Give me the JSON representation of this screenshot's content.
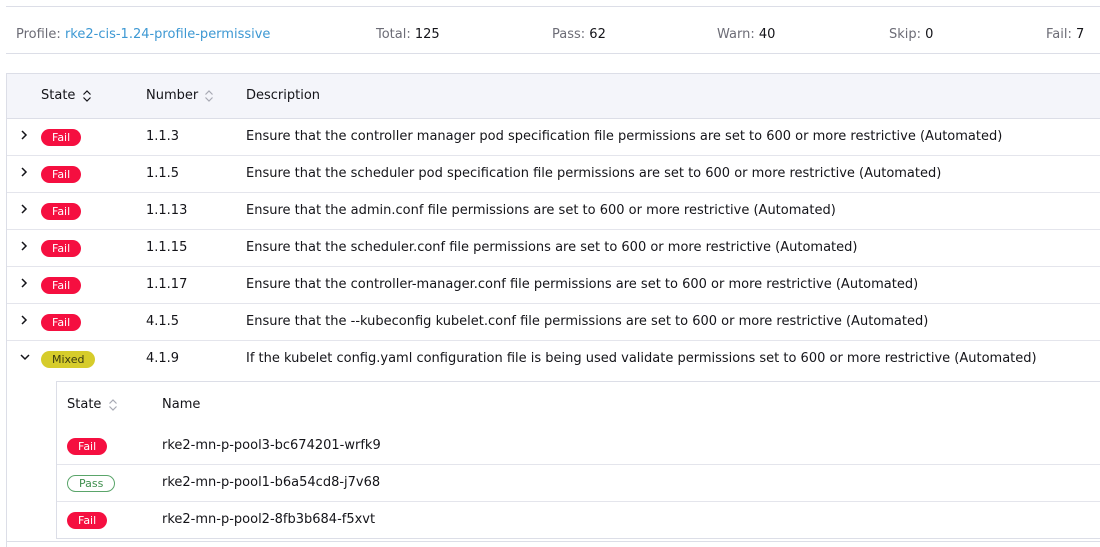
{
  "summary": {
    "profile_label": "Profile:",
    "profile_value": "rke2-cis-1.24-profile-permissive",
    "total_label": "Total:",
    "total_value": "125",
    "pass_label": "Pass:",
    "pass_value": "62",
    "warn_label": "Warn:",
    "warn_value": "40",
    "skip_label": "Skip:",
    "skip_value": "0",
    "fail_label": "Fail:",
    "fail_value": "7"
  },
  "table": {
    "headers": {
      "state": "State",
      "number": "Number",
      "description": "Description"
    },
    "rows": [
      {
        "state": "Fail",
        "number": "1.1.3",
        "description": "Ensure that the controller manager pod specification file permissions are set to 600 or more restrictive (Automated)"
      },
      {
        "state": "Fail",
        "number": "1.1.5",
        "description": "Ensure that the scheduler pod specification file permissions are set to 600 or more restrictive (Automated)"
      },
      {
        "state": "Fail",
        "number": "1.1.13",
        "description": "Ensure that the admin.conf file permissions are set to 600 or more restrictive (Automated)"
      },
      {
        "state": "Fail",
        "number": "1.1.15",
        "description": "Ensure that the scheduler.conf file permissions are set to 600 or more restrictive (Automated)"
      },
      {
        "state": "Fail",
        "number": "1.1.17",
        "description": "Ensure that the controller-manager.conf file permissions are set to 600 or more restrictive (Automated)"
      },
      {
        "state": "Fail",
        "number": "4.1.5",
        "description": "Ensure that the --kubeconfig kubelet.conf file permissions are set to 600 or more restrictive (Automated)"
      },
      {
        "state": "Mixed",
        "number": "4.1.9",
        "description": "If the kubelet config.yaml configuration file is being used validate permissions set to 600 or more restrictive (Automated)"
      }
    ],
    "expanded": {
      "headers": {
        "state": "State",
        "name": "Name"
      },
      "rows": [
        {
          "state": "Fail",
          "name": "rke2-mn-p-pool3-bc674201-wrfk9"
        },
        {
          "state": "Pass",
          "name": "rke2-mn-p-pool1-b6a54cd8-j7v68"
        },
        {
          "state": "Fail",
          "name": "rke2-mn-p-pool2-8fb3b684-f5xvt"
        }
      ]
    }
  },
  "icons": {
    "collapsed": "chevron-right-icon",
    "expanded": "chevron-down-icon",
    "sort": "sort-icon"
  },
  "colors": {
    "fail": "#f50f40",
    "mixed": "#d6cc2b",
    "pass": "#3f8f4d",
    "link": "#3d98d3",
    "header_bg": "#f4f5fa"
  }
}
